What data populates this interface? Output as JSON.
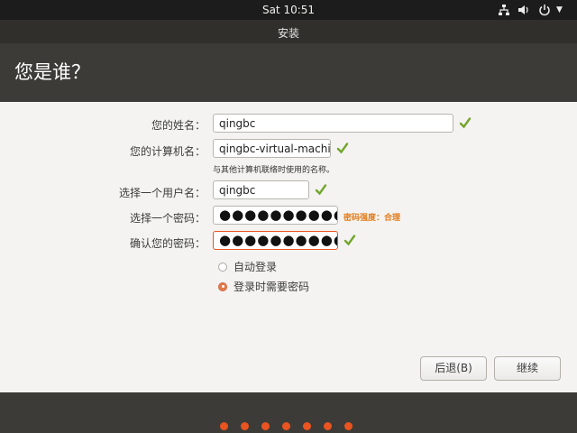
{
  "top_panel": {
    "clock": "Sat 10:51",
    "tray_icons": [
      "network-icon",
      "volume-icon",
      "power-icon",
      "chevron-down-icon"
    ]
  },
  "window": {
    "title": "安装"
  },
  "page": {
    "title": "您是谁？"
  },
  "form": {
    "name_label": "您的姓名：",
    "name_value": "qingbc",
    "computer_label": "您的计算机名：",
    "computer_value": "qingbc-virtual-machine",
    "computer_hint": "与其他计算机联络时使用的名称。",
    "username_label": "选择一个用户名：",
    "username_value": "qingbc",
    "password_label": "选择一个密码：",
    "password_value": "●●●●●●●●●●",
    "password_strength": "密码强度：合理",
    "confirm_label": "确认您的密码：",
    "confirm_value": "●●●●●●●●●●",
    "login_options": [
      {
        "label": "自动登录",
        "selected": false
      },
      {
        "label": "登录时需要密码",
        "selected": true
      }
    ]
  },
  "buttons": {
    "back": "后退(B)",
    "continue": "继续"
  },
  "progress": {
    "step_count": 7
  },
  "colors": {
    "accent": "#e95420",
    "check": "#73a52d",
    "strength": "#e27a19"
  }
}
